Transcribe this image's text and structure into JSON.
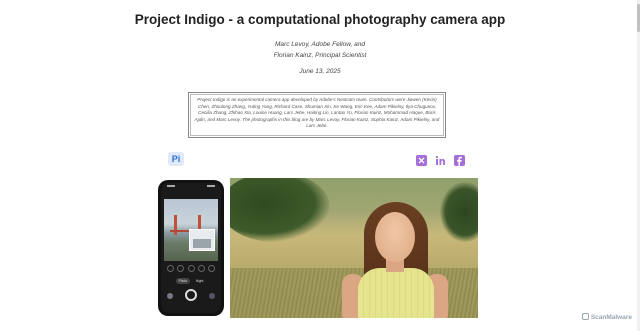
{
  "article": {
    "title": "Project Indigo - a computational photography camera app",
    "authors_line1": "Marc Levoy, Adobe Fellow, and",
    "authors_line2": "Florian Kainz, Principal Scientist",
    "date": "June 13, 2025",
    "abstract": "Project Indigo is an experimental camera app developed by Adobe's Nextcam team. Contributors were Jiawen (Kevin) Chen, Zhoulong Zhang, Yuting Yang, Richard Case, Shumian Xin, Ke Wang, Eric Kee, Adam Pikielny, Ilya Chugunov, Cecilia Zhang, Zhihao Xia, Louise Huang, Lars Jebe, Haiting Lin, Lantao Yu, Florian Kainz, Mohammad Haque, Boris Ajdin, and Marc Levoy. The photographs in this blog are by Marc Levoy, Florian Kainz, Sophia Kainz, Adam Pikielny, and Lars Jebe."
  },
  "logo": {
    "text": "Pi",
    "icon": "project-indigo-logo",
    "color": "#2d6fd0"
  },
  "share": {
    "icons": [
      "x-icon",
      "linkedin-icon",
      "facebook-icon"
    ],
    "accent": "#a46fd8"
  },
  "phone_ui": {
    "modes": [
      "Photo",
      "Night"
    ]
  },
  "watermark": {
    "text": "ScanMalware"
  }
}
